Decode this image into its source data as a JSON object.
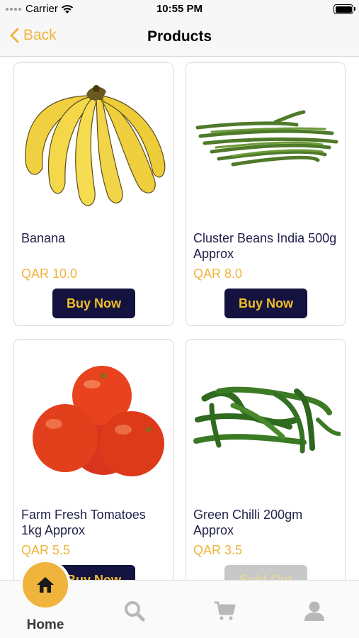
{
  "status_bar": {
    "carrier": "Carrier",
    "time": "10:55 PM"
  },
  "nav": {
    "back_label": "Back",
    "title": "Products"
  },
  "products": [
    {
      "name": "Banana",
      "price": "QAR 10.0",
      "button": "Buy Now",
      "image": "banana"
    },
    {
      "name": "Cluster Beans India 500g Approx",
      "price": "QAR 8.0",
      "button": "Buy Now",
      "image": "cluster-beans"
    },
    {
      "name": "Farm Fresh Tomatoes 1kg Approx",
      "price": "QAR 5.5",
      "button": "Buy Now",
      "image": "tomatoes"
    },
    {
      "name": "Green Chilli 200gm Approx",
      "price": "QAR 3.5",
      "button": "Sold Out",
      "image": "green-chilli"
    }
  ],
  "tab_bar": {
    "home_label": "Home",
    "tabs": [
      "home-icon",
      "search-icon",
      "cart-icon",
      "profile-icon"
    ]
  },
  "colors": {
    "accent": "#f0b43c",
    "button_bg": "#14123f",
    "button_text": "#f2c028",
    "sold_out_bg": "#c8c8c8",
    "text": "#1f1f4a"
  }
}
